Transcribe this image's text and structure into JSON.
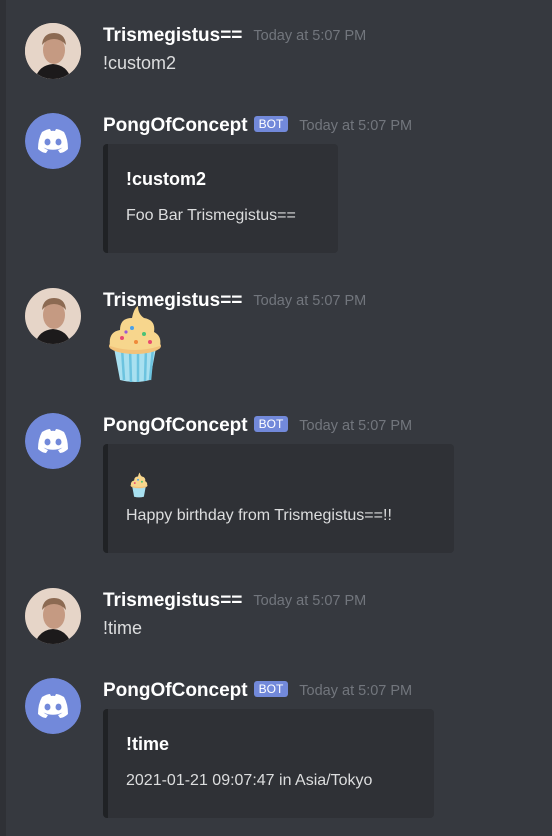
{
  "messages": [
    {
      "author": "Trismegistus==",
      "timestamp": "Today at 5:07 PM",
      "text": "!custom2"
    },
    {
      "author": "PongOfConcept",
      "badge": "BOT",
      "timestamp": "Today at 5:07 PM",
      "embed": {
        "title": "!custom2",
        "description": "Foo Bar Trismegistus=="
      }
    },
    {
      "author": "Trismegistus==",
      "timestamp": "Today at 5:07 PM",
      "emoji": "cupcake"
    },
    {
      "author": "PongOfConcept",
      "badge": "BOT",
      "timestamp": "Today at 5:07 PM",
      "embed": {
        "emoji": "cupcake",
        "description": "Happy birthday from Trismegistus==!!"
      }
    },
    {
      "author": "Trismegistus==",
      "timestamp": "Today at 5:07 PM",
      "text": "!time"
    },
    {
      "author": "PongOfConcept",
      "badge": "BOT",
      "timestamp": "Today at 5:07 PM",
      "embed": {
        "title": "!time",
        "description": "2021-01-21 09:07:47 in Asia/Tokyo"
      }
    }
  ],
  "colors": {
    "background": "#36393f",
    "embed_background": "#2f3136",
    "embed_border": "#202225",
    "bot_badge": "#7289da",
    "discord_blurple": "#7289da",
    "timestamp": "#72767d",
    "username": "#ffffff",
    "text": "#dcddde"
  }
}
